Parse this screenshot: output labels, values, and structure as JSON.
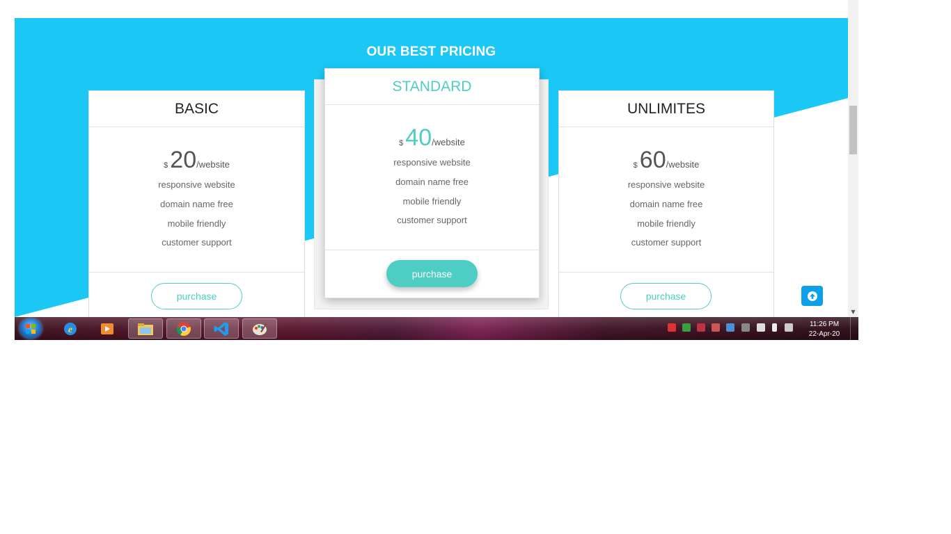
{
  "section": {
    "title": "OUR BEST PRICING"
  },
  "colors": {
    "hero": "#1bc8f5",
    "accent": "#4ecdc4",
    "scroll_top": "#0d9fe8"
  },
  "plans": [
    {
      "name": "BASIC",
      "currency": "$",
      "amount": "20",
      "period": "/website",
      "features": [
        "responsive website",
        "domain name free",
        "mobile friendly",
        "customer support"
      ],
      "button": "purchase"
    },
    {
      "name": "STANDARD",
      "currency": "$",
      "amount": "40",
      "period": "/website",
      "features": [
        "responsive website",
        "domain name free",
        "mobile friendly",
        "customer support"
      ],
      "button": "purchase"
    },
    {
      "name": "UNLIMITES",
      "currency": "$",
      "amount": "60",
      "period": "/website",
      "features": [
        "responsive website",
        "domain name free",
        "mobile friendly",
        "customer support"
      ],
      "button": "purchase"
    }
  ],
  "scroll_top_icon": "arrow-up-icon",
  "taskbar": {
    "apps": [
      "windows-start-icon",
      "internet-explorer-icon",
      "media-player-icon",
      "file-explorer-icon",
      "chrome-icon",
      "vscode-icon",
      "paint-icon"
    ],
    "clock": {
      "time": "11:26 PM",
      "date": "22-Apr-20"
    }
  }
}
